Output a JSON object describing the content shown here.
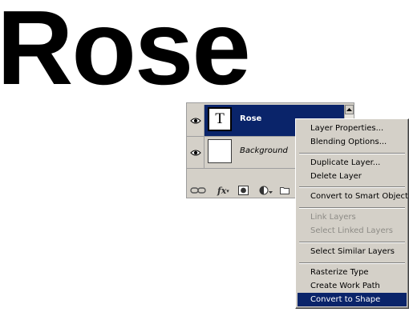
{
  "canvas": {
    "text": "Rose"
  },
  "layers_panel": {
    "layers": [
      {
        "name": "Rose",
        "thumbnail_glyph": "T",
        "selected": true,
        "visible": true
      },
      {
        "name": "Background",
        "thumbnail_glyph": "",
        "selected": false,
        "visible": true
      }
    ],
    "footer_icons": [
      "link-layers-icon",
      "fx-icon",
      "layer-mask-icon",
      "adjustment-layer-icon",
      "new-group-icon"
    ],
    "fx_label": "fx"
  },
  "context_menu": {
    "items": {
      "layer_properties": "Layer Properties...",
      "blending_options": "Blending Options...",
      "duplicate_layer": "Duplicate Layer...",
      "delete_layer": "Delete Layer",
      "convert_smart_object": "Convert to Smart Object",
      "link_layers": "Link Layers",
      "select_linked_layers": "Select Linked Layers",
      "select_similar_layers": "Select Similar Layers",
      "rasterize_type": "Rasterize Type",
      "create_work_path": "Create Work Path",
      "convert_to_shape": "Convert to Shape"
    },
    "disabled": [
      "link_layers",
      "select_linked_layers"
    ],
    "highlighted": "convert_to_shape"
  },
  "colors": {
    "selection": "#0a246a",
    "panel_bg": "#d4d0c8",
    "disabled_text": "#8d8b86"
  }
}
